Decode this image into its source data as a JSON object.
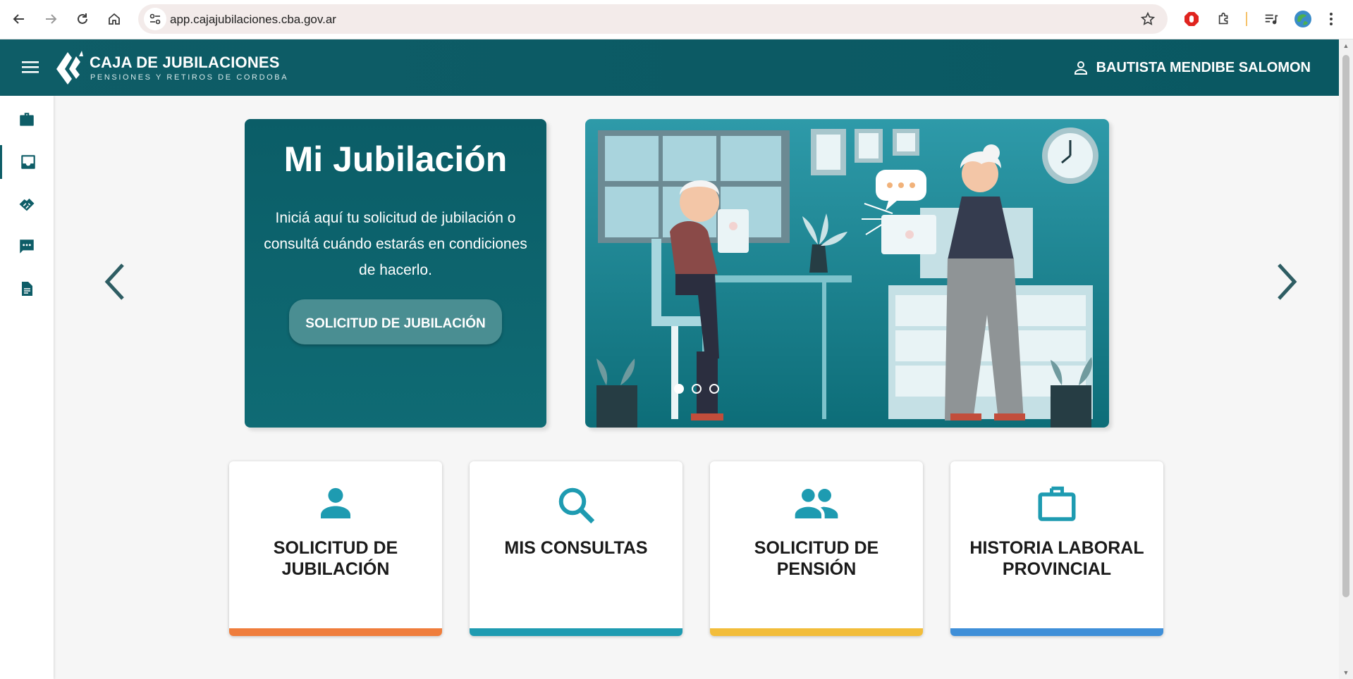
{
  "browser": {
    "url": "app.cajajubilaciones.cba.gov.ar"
  },
  "header": {
    "logo_title": "CAJA DE JUBILACIONES",
    "logo_subtitle": "PENSIONES Y RETIROS DE CORDOBA",
    "user_name": "BAUTISTA MENDIBE SALOMON",
    "bg_color": "#0e5d67"
  },
  "sidebar": {
    "items": [
      {
        "icon": "briefcase-icon"
      },
      {
        "icon": "inbox-icon"
      },
      {
        "icon": "handshake-icon"
      },
      {
        "icon": "chat-icon"
      },
      {
        "icon": "document-icon"
      }
    ]
  },
  "carousel": {
    "title": "Mi Jubilación",
    "text": "Iniciá aquí tu solicitud de jubilación o consultá cuándo estarás en condiciones de hacerlo.",
    "button_label": "SOLICITUD DE JUBILACIÓN",
    "slide_count": 3,
    "active_slide": 1
  },
  "cards": [
    {
      "label": "SOLICITUD DE JUBILACIÓN",
      "icon": "person-icon",
      "accent": "#ef7d3c"
    },
    {
      "label": "MIS CONSULTAS",
      "icon": "search-icon",
      "accent": "#1e9bb1"
    },
    {
      "label": "SOLICITUD DE PENSIÓN",
      "icon": "people-icon",
      "accent": "#f2bd3a"
    },
    {
      "label": "HISTORIA LABORAL PROVINCIAL",
      "icon": "work-icon",
      "accent": "#3f8fd8"
    }
  ]
}
